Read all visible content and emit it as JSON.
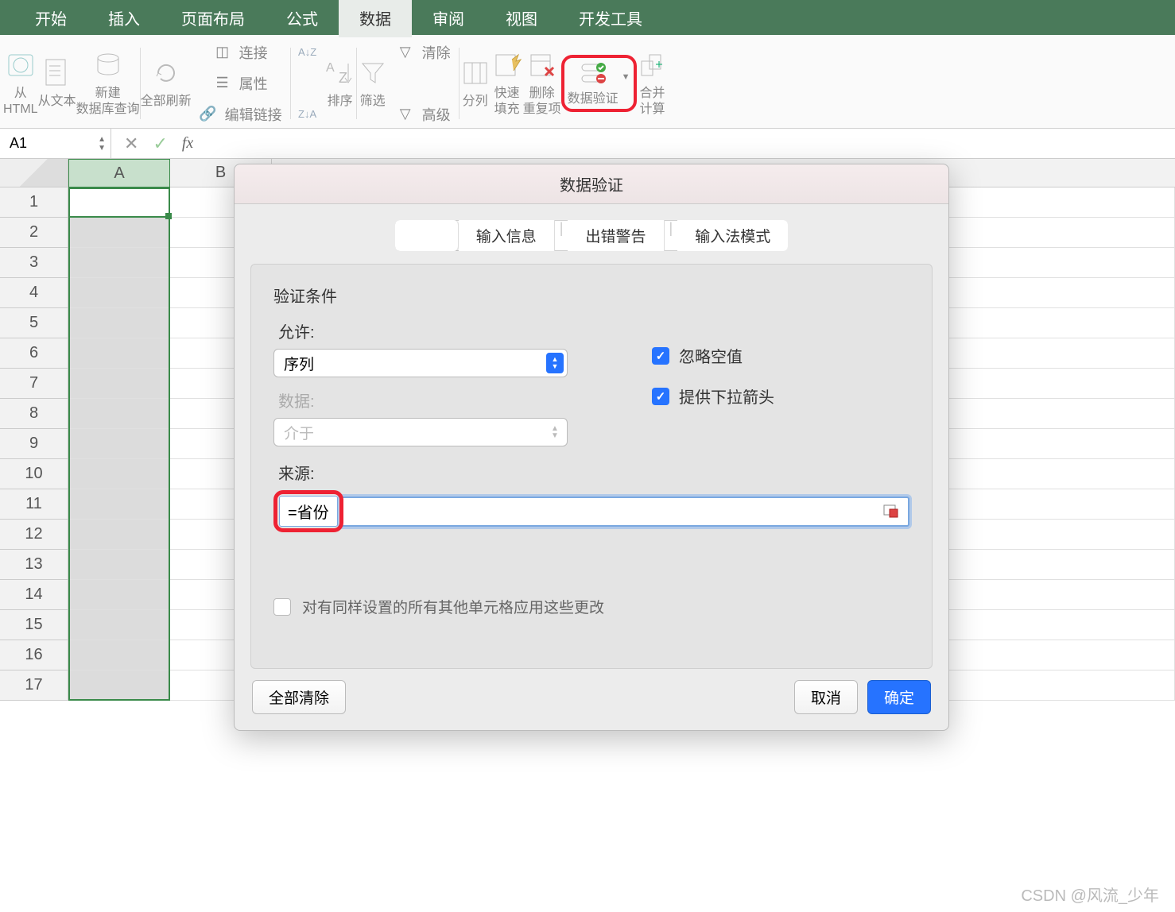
{
  "ribbon": {
    "tabs": [
      "开始",
      "插入",
      "页面布局",
      "公式",
      "数据",
      "审阅",
      "视图",
      "开发工具"
    ],
    "active_tab_index": 4,
    "groups": {
      "fromHtml": "从\nHTML",
      "fromText": "从文本",
      "newQuery": "新建\n数据库查询",
      "refreshAll": "全部刷新",
      "connections": "连接",
      "properties": "属性",
      "editLinks": "编辑链接",
      "sort": "排序",
      "filter": "筛选",
      "clear": "清除",
      "advanced": "高级",
      "textToCols": "分列",
      "flashFill": "快速\n填充",
      "removeDup": "删除\n重复项",
      "dataValidation": "数据验证",
      "consolidate": "合并\n计算"
    }
  },
  "formula_bar": {
    "cell_ref": "A1",
    "formula": ""
  },
  "sheet": {
    "columns": [
      "A",
      "B"
    ],
    "selected_col": "A",
    "rows": [
      1,
      2,
      3,
      4,
      5,
      6,
      7,
      8,
      9,
      10,
      11,
      12,
      13,
      14,
      15,
      16,
      17
    ]
  },
  "dialog": {
    "title": "数据验证",
    "tabs": {
      "settings": "",
      "input_msg": "输入信息",
      "error_alert": "出错警告",
      "ime_mode": "输入法模式"
    },
    "section_title": "验证条件",
    "allow_label": "允许:",
    "allow_value": "序列",
    "data_label": "数据:",
    "data_value": "介于",
    "ignore_blank": "忽略空值",
    "dropdown": "提供下拉箭头",
    "source_label": "来源:",
    "source_value": "=省份",
    "apply_all": "对有同样设置的所有其他单元格应用这些更改",
    "clear_all": "全部清除",
    "cancel": "取消",
    "ok": "确定"
  },
  "watermark": "CSDN @风流_少年"
}
